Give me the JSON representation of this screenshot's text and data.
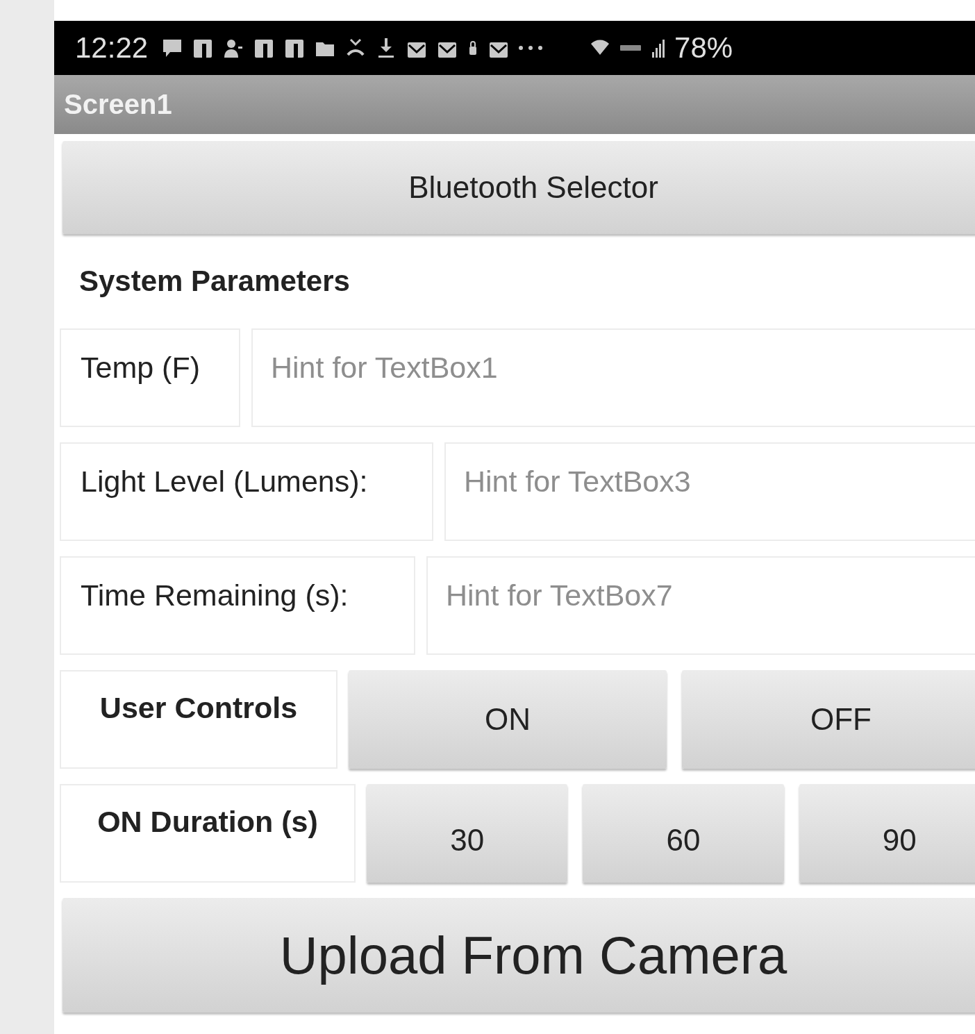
{
  "status_bar": {
    "time": "12:22",
    "battery": "78%"
  },
  "title_bar": {
    "title": "Screen1"
  },
  "bluetooth_button": {
    "label": "Bluetooth Selector"
  },
  "section_heading": "System Parameters",
  "fields": [
    {
      "label": "Temp (F)",
      "placeholder": "Hint for TextBox1"
    },
    {
      "label": "Light Level (Lumens):",
      "placeholder": "Hint for TextBox3"
    },
    {
      "label": "Time Remaining (s):",
      "placeholder": "Hint for TextBox7"
    }
  ],
  "user_controls": {
    "label": "User Controls",
    "buttons": [
      "ON",
      "OFF"
    ]
  },
  "on_duration": {
    "label": "ON Duration (s)",
    "buttons": [
      "30",
      "60",
      "90"
    ]
  },
  "upload_button": {
    "label": "Upload From Camera"
  }
}
